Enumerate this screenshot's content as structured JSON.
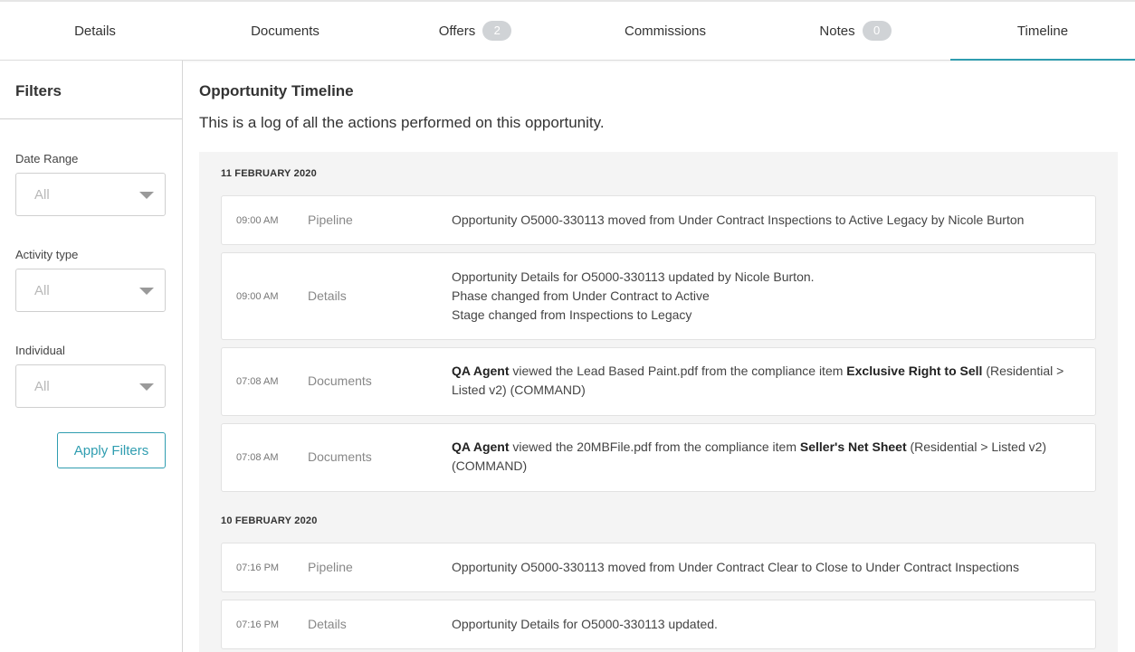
{
  "tabs": [
    {
      "label": "Details"
    },
    {
      "label": "Documents"
    },
    {
      "label": "Offers",
      "badge": "2"
    },
    {
      "label": "Commissions"
    },
    {
      "label": "Notes",
      "badge": "0"
    },
    {
      "label": "Timeline",
      "active": true
    }
  ],
  "sidebar": {
    "title": "Filters",
    "date_range": {
      "label": "Date Range",
      "value": "All"
    },
    "activity_type": {
      "label": "Activity type",
      "value": "All"
    },
    "individual": {
      "label": "Individual",
      "value": "All"
    },
    "apply_label": "Apply Filters"
  },
  "main": {
    "title": "Opportunity Timeline",
    "subtitle": "This is a log of all the actions performed on this opportunity."
  },
  "timeline": [
    {
      "date": "11 FEBRUARY 2020",
      "entries": [
        {
          "time": "09:00 AM",
          "category": "Pipeline",
          "line1": "Opportunity O5000-330113 moved from Under Contract Inspections to Active Legacy by Nicole Burton"
        },
        {
          "time": "09:00 AM",
          "category": "Details",
          "line1": "Opportunity Details for O5000-330113 updated by Nicole Burton.",
          "line2": "Phase changed from Under Contract to Active",
          "line3": "Stage changed from Inspections to Legacy"
        },
        {
          "time": "07:08 AM",
          "category": "Documents",
          "actor": "QA Agent",
          "mid": " viewed the Lead Based Paint.pdf from the compliance item ",
          "item": "Exclusive Right to Sell",
          "tail": " (Residential > Listed v2) (COMMAND)"
        },
        {
          "time": "07:08 AM",
          "category": "Documents",
          "actor": "QA Agent",
          "mid": " viewed the 20MBFile.pdf from the compliance item ",
          "item": "Seller's Net Sheet",
          "tail": " (Residential > Listed v2) (COMMAND)"
        }
      ]
    },
    {
      "date": "10 FEBRUARY 2020",
      "entries": [
        {
          "time": "07:16 PM",
          "category": "Pipeline",
          "line1": "Opportunity O5000-330113 moved from Under Contract Clear to Close to Under Contract Inspections"
        },
        {
          "time": "07:16 PM",
          "category": "Details",
          "line1": "Opportunity Details for O5000-330113 updated."
        }
      ]
    }
  ],
  "colors": {
    "accent": "#2f9db0",
    "badge": "#d0d3d6",
    "log_bg": "#f4f4f4"
  }
}
